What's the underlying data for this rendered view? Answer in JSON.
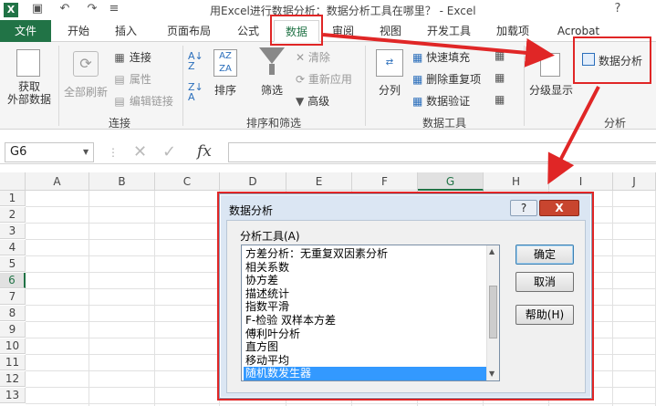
{
  "window": {
    "title": "用Excel进行数据分析：数据分析工具在哪里？ - Excel"
  },
  "tabs": [
    "文件",
    "开始",
    "插入",
    "页面布局",
    "公式",
    "数据",
    "审阅",
    "视图",
    "开发工具",
    "加载项",
    "Acrobat"
  ],
  "ribbon": {
    "get_external": "获取\n外部数据",
    "refresh_all": "全部刷新",
    "connections": "连接",
    "properties": "属性",
    "edit_links": "编辑链接",
    "group_connections": "连接",
    "sort": "排序",
    "filter": "筛选",
    "clear": "清除",
    "reapply": "重新应用",
    "advanced": "高级",
    "group_sort_filter": "排序和筛选",
    "text_to_columns": "分列",
    "flash_fill": "快速填充",
    "remove_duplicates": "删除重复项",
    "data_validation": "数据验证",
    "group_data_tools": "数据工具",
    "outline": "分级显示",
    "data_analysis": "数据分析",
    "group_analysis": "分析"
  },
  "formula_bar": {
    "name_box": "G6",
    "fx": "fx"
  },
  "columns": [
    "A",
    "B",
    "C",
    "D",
    "E",
    "F",
    "G",
    "H",
    "I",
    "J"
  ],
  "rows": [
    "1",
    "2",
    "3",
    "4",
    "5",
    "6",
    "7",
    "8",
    "9",
    "10",
    "11",
    "12",
    "13"
  ],
  "dialog": {
    "title": "数据分析",
    "help_icon": "?",
    "close_icon": "X",
    "tools_label": "分析工具(A)",
    "items": [
      "方差分析：无重复双因素分析",
      "相关系数",
      "协方差",
      "描述统计",
      "指数平滑",
      "F-检验 双样本方差",
      "傅利叶分析",
      "直方图",
      "移动平均",
      "随机数发生器"
    ],
    "selected_index": 9,
    "ok": "确定",
    "cancel": "取消",
    "help": "帮助(H)"
  },
  "accent": "#217346",
  "annotation_color": "#e02626"
}
